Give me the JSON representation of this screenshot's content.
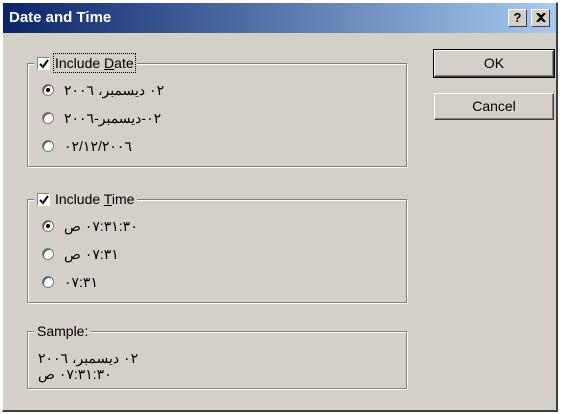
{
  "window": {
    "title": "Date and Time"
  },
  "titlebar_buttons": {
    "help": "?",
    "close": "✕"
  },
  "include_date": {
    "label_pre": "Include ",
    "label_accel": "D",
    "label_post": "ate",
    "checked": true,
    "options": [
      {
        "label": "٠٢ ديسمبر، ٢٠٠٦",
        "selected": true
      },
      {
        "label": "٠٢-ديسمبر-٢٠٠٦",
        "selected": false
      },
      {
        "label": "٠٢/١٢/٢٠٠٦",
        "selected": false
      }
    ]
  },
  "include_time": {
    "label_pre": "Include ",
    "label_accel": "T",
    "label_post": "ime",
    "checked": true,
    "options": [
      {
        "label": "٠٧:٣١:٣٠ ص",
        "selected": true
      },
      {
        "label": "٠٧:٣١ ص",
        "selected": false
      },
      {
        "label": "٠٧:٣١",
        "selected": false
      }
    ]
  },
  "sample": {
    "label": "Sample:",
    "line1": "٠٢ ديسمبر، ٢٠٠٦",
    "line2": "٠٧:٣١:٣٠ ص"
  },
  "buttons": {
    "ok": "OK",
    "cancel": "Cancel"
  }
}
